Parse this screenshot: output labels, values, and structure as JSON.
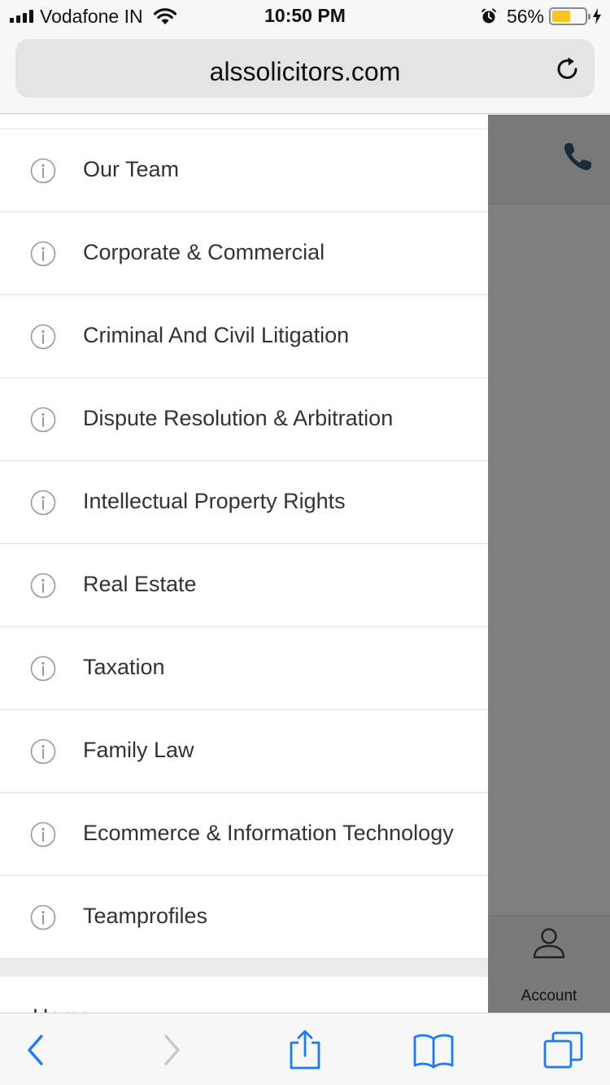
{
  "status_bar": {
    "carrier": "Vodafone IN",
    "time": "10:50 PM",
    "battery_percent_label": "56%",
    "battery_level": 0.56,
    "battery_color": "#f4c51d"
  },
  "browser": {
    "url": "alssolicitors.com",
    "reload_icon": "reload-icon"
  },
  "menu": {
    "items": [
      {
        "label": "Our Team",
        "icon": "info-icon"
      },
      {
        "label": "Corporate & Commercial",
        "icon": "info-icon"
      },
      {
        "label": "Criminal And Civil Litigation",
        "icon": "info-icon"
      },
      {
        "label": "Dispute Resolution & Arbitration",
        "icon": "info-icon"
      },
      {
        "label": "Intellectual Property Rights",
        "icon": "info-icon"
      },
      {
        "label": "Real Estate",
        "icon": "info-icon"
      },
      {
        "label": "Taxation",
        "icon": "info-icon"
      },
      {
        "label": "Family Law",
        "icon": "info-icon"
      },
      {
        "label": "Ecommerce & Information Technology",
        "icon": "info-icon"
      },
      {
        "label": "Teamprofiles",
        "icon": "info-icon"
      }
    ],
    "next_section_label": "Home"
  },
  "overlay": {
    "phone_icon": "phone-icon",
    "account_label": "Account",
    "phone_color": "#1b2a3a"
  },
  "toolbar": {
    "back_icon": "back-icon",
    "forward_icon": "forward-icon",
    "share_icon": "share-icon",
    "bookmarks_icon": "bookmarks-icon",
    "tabs_icon": "tabs-icon",
    "accent_color": "#1a7cf5"
  }
}
